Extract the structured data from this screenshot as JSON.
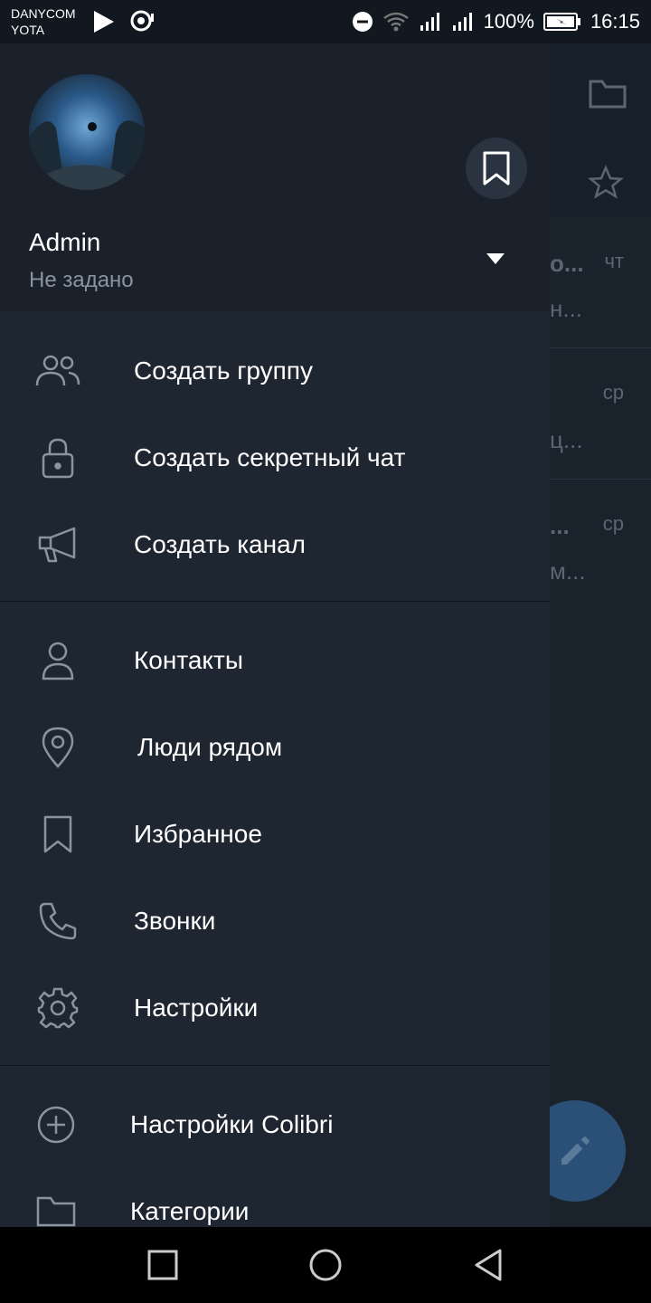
{
  "status_bar": {
    "carrier_1": "DANYCOM",
    "carrier_2": "YOTA",
    "battery": "100%",
    "time": "16:15"
  },
  "background_list": {
    "rows": [
      {
        "snippet_1": "о...",
        "snippet_2": "н...",
        "time": "чт"
      },
      {
        "snippet_1": "",
        "snippet_2": "ц...",
        "time": "ср"
      },
      {
        "snippet_1": "...",
        "snippet_2": "м...",
        "time": "ср"
      }
    ]
  },
  "drawer": {
    "user_name": "Admin",
    "user_status": "Не задано",
    "menu_group_1": [
      {
        "label": "Создать группу",
        "icon": "group-icon"
      },
      {
        "label": "Создать секретный чат",
        "icon": "lock-icon"
      },
      {
        "label": "Создать канал",
        "icon": "megaphone-icon"
      }
    ],
    "menu_group_2": [
      {
        "label": "Контакты",
        "icon": "person-icon"
      },
      {
        "label": "Люди рядом",
        "icon": "location-pin-icon"
      },
      {
        "label": "Избранное",
        "icon": "bookmark-icon"
      },
      {
        "label": "Звонки",
        "icon": "phone-icon"
      },
      {
        "label": "Настройки",
        "icon": "gear-icon"
      }
    ],
    "menu_group_3": [
      {
        "label": "Настройки Colibri",
        "icon": "add-circle-icon"
      },
      {
        "label": "Категории",
        "icon": "folder-icon"
      }
    ]
  },
  "colors": {
    "drawer_bg": "#1e2632",
    "header_bg": "#1a212b",
    "icon_stroke": "#8a949e",
    "fab": "#2b5078"
  }
}
